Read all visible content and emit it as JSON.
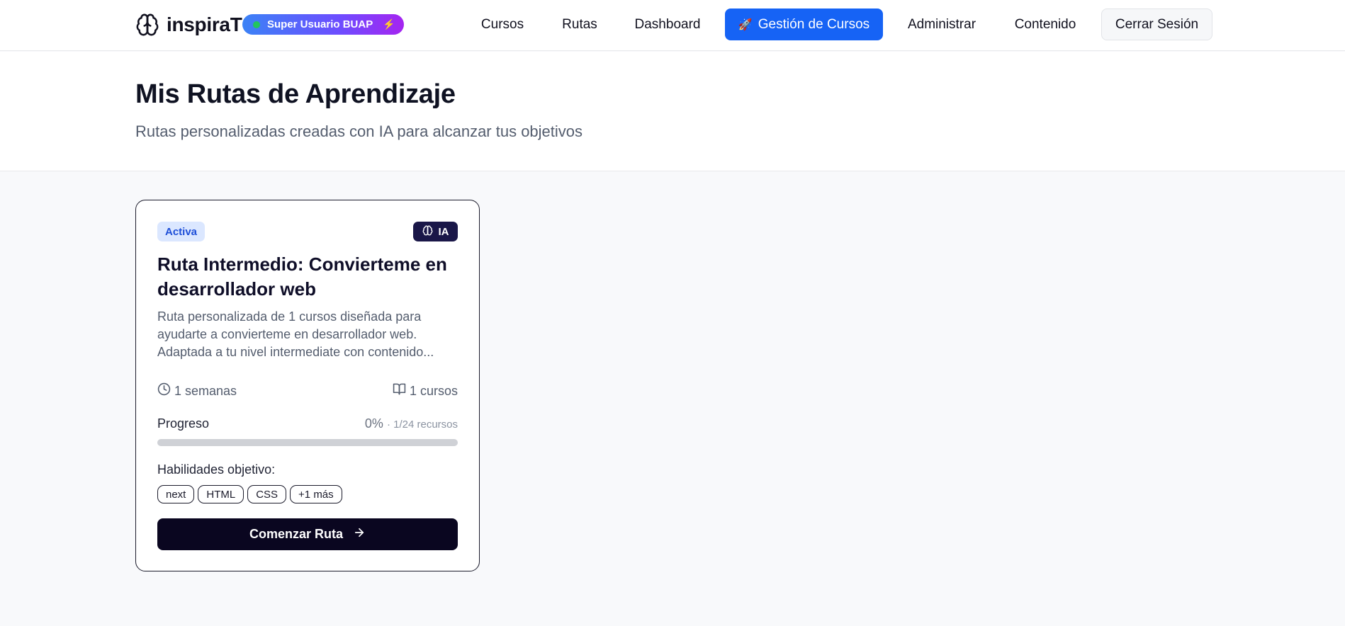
{
  "navbar": {
    "brand_name": "inspiraT",
    "super_badge": "Super Usuario BUAP",
    "links": [
      "Cursos",
      "Rutas",
      "Dashboard"
    ],
    "active_link": "Gestión de Cursos",
    "links_after": [
      "Administrar",
      "Contenido"
    ],
    "logout_label": "Cerrar Sesión"
  },
  "header": {
    "title": "Mis Rutas de Aprendizaje",
    "subtitle": "Rutas personalizadas creadas con IA para alcanzar tus objetivos"
  },
  "card": {
    "status": "Activa",
    "ia_label": "IA",
    "title": "Ruta Intermedio: Convierteme en desarrollador web",
    "description": "Ruta personalizada de 1 cursos diseñada para ayudarte a convierteme en desarrollador web. Adaptada a tu nivel intermediate con contenido...",
    "duration": "1 semanas",
    "courses": "1 cursos",
    "progress_label": "Progreso",
    "progress_percent": "0%",
    "progress_resources": "· 1/24 recursos",
    "progress_fraction": 0,
    "skills_label": "Habilidades objetivo:",
    "skills": [
      "next",
      "HTML",
      "CSS",
      "+1 más"
    ],
    "cta_label": "Comenzar Ruta"
  },
  "colors": {
    "accent": "#1663f5",
    "dark": "#0a0620",
    "ia_badge": "#1a1748"
  },
  "icons": {
    "brand": "brain-icon",
    "bolt": "bolt-icon",
    "rocket": "rocket-icon",
    "clock": "clock-icon",
    "book": "book-open-icon",
    "arrow": "arrow-right-icon"
  }
}
